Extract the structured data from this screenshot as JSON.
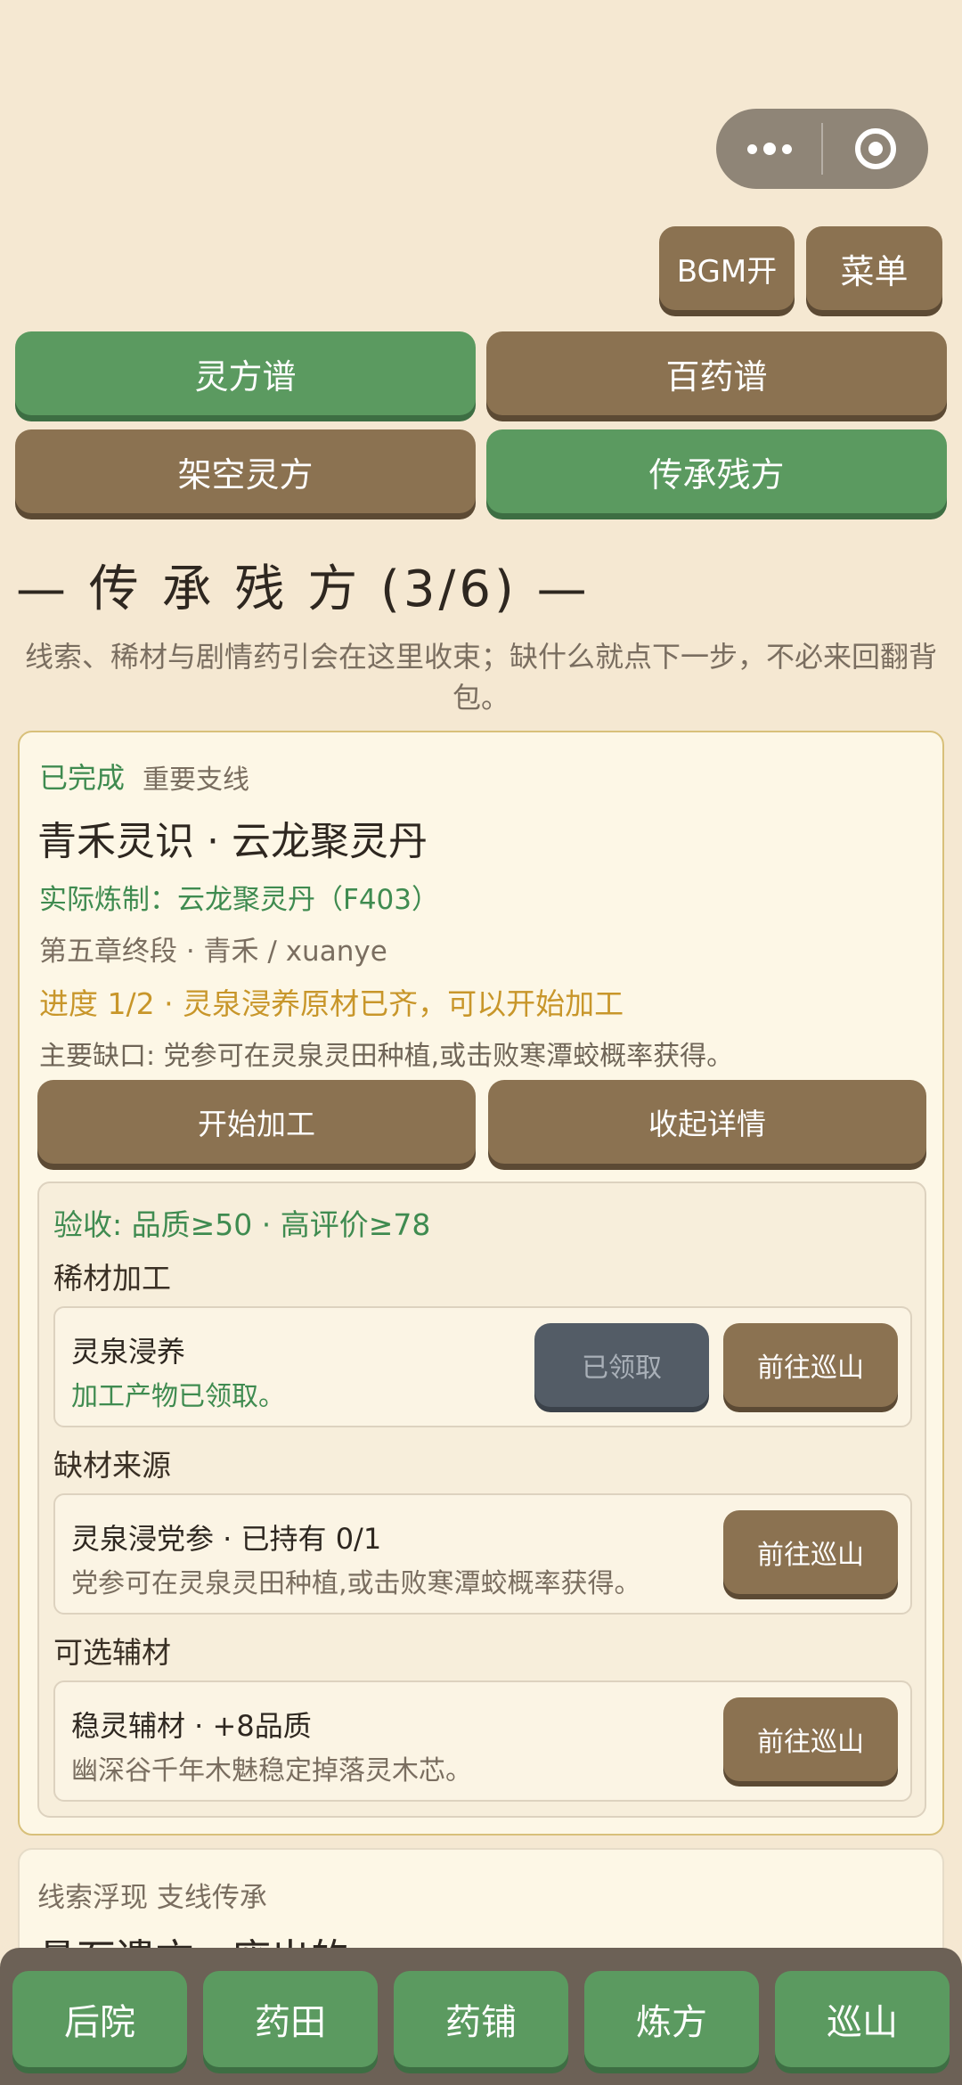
{
  "topbar": {
    "bgm_label": "BGM开",
    "menu_label": "菜单"
  },
  "tabs": [
    {
      "label": "灵方谱"
    },
    {
      "label": "百药谱"
    },
    {
      "label": "架空灵方"
    },
    {
      "label": "传承残方"
    }
  ],
  "section": {
    "title": "— 传 承 残 方 (3/6) —",
    "intro": "线索、稀材与剧情药引会在这里收束；缺什么就点下一步，不必来回翻背包。"
  },
  "quest": {
    "status": "已完成",
    "type": "重要支线",
    "title": "青禾灵识 · 云龙聚灵丹",
    "actual": "实际炼制：云龙聚灵丹（F403）",
    "chapter": "第五章终段 · 青禾 / xuanye",
    "progress": "进度 1/2 · 灵泉浸养原材已齐，可以开始加工",
    "main_gap": "主要缺口: 党参可在灵泉灵田种植,或击败寒潭蛟概率获得。",
    "start_btn": "开始加工",
    "collapse_btn": "收起详情",
    "detail": {
      "acceptance": "验收: 品质≥50 · 高评价≥78",
      "rare_section": "稀材加工",
      "rare_item": {
        "title": "灵泉浸养",
        "sub": "加工产物已领取。",
        "claimed_btn": "已领取",
        "go_btn": "前往巡山"
      },
      "missing_section": "缺材来源",
      "missing_item": {
        "title": "灵泉浸党参 · 已持有 0/1",
        "sub": "党参可在灵泉灵田种植,或击败寒潭蛟概率获得。",
        "go_btn": "前往巡山"
      },
      "optional_section": "可选辅材",
      "optional_item": {
        "title": "稳灵辅材 · +8品质",
        "sub": "幽深谷千年木魅稳定掉落灵木芯。",
        "go_btn": "前往巡山"
      }
    }
  },
  "next_quest": {
    "tag": "线索浮现  支线传承",
    "title": "悬石遗方 · 废出的"
  },
  "bottom_nav": [
    {
      "label": "后院"
    },
    {
      "label": "药田"
    },
    {
      "label": "药铺"
    },
    {
      "label": "炼方"
    },
    {
      "label": "巡山"
    }
  ]
}
